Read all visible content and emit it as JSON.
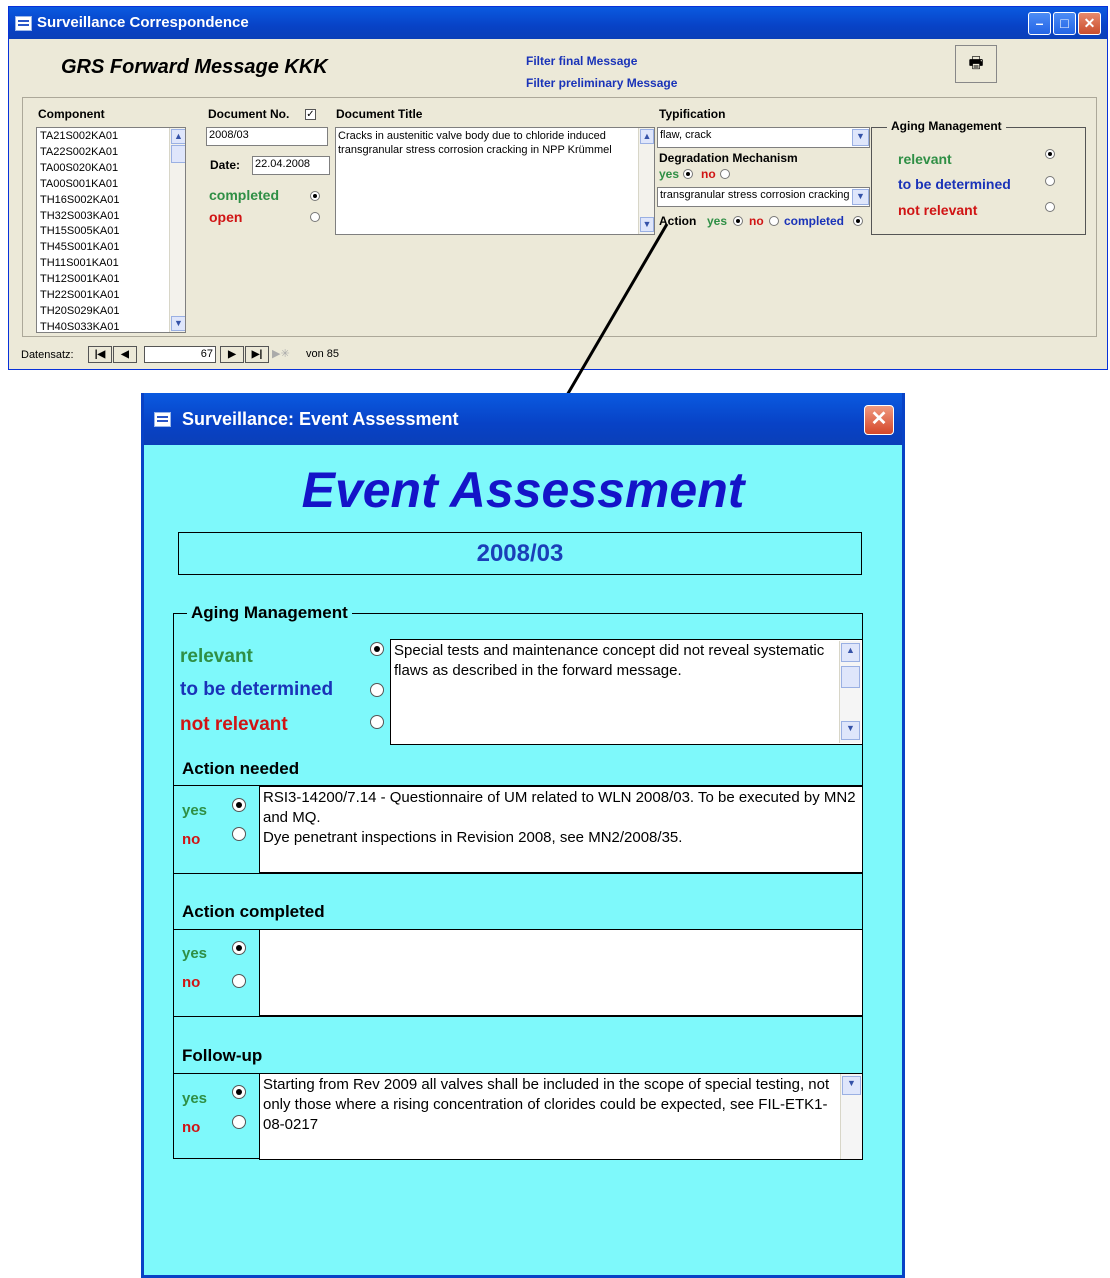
{
  "win1": {
    "title": "Surveillance Correspondence",
    "heading": "GRS Forward Message KKK",
    "filter_final": "Filter final Message",
    "filter_preliminary": "Filter preliminary Message",
    "component_label": "Component",
    "components": [
      "TA21S002KA01",
      "TA22S002KA01",
      "TA00S020KA01",
      "TA00S001KA01",
      "TH16S002KA01",
      "TH32S003KA01",
      "TH15S005KA01",
      "TH45S001KA01",
      "TH11S001KA01",
      "TH12S001KA01",
      "TH22S001KA01",
      "TH20S029KA01",
      "TH40S033KA01"
    ],
    "docno_label": "Document No.",
    "docno_value": "2008/03",
    "date_label": "Date:",
    "date_value": "22.04.2008",
    "completed_label": "completed",
    "open_label": "open",
    "doctitle_label": "Document Title",
    "doctitle_value": "Cracks in austenitic valve body due to chloride induced transgranular stress corrosion cracking in NPP Krümmel",
    "typification_label": "Typification",
    "typification_value": "flaw, crack",
    "degradation_label": "Degradation Mechanism",
    "yes": "yes",
    "no": "no",
    "degradation_value": "transgranular stress corrosion cracking",
    "action_label": "Action",
    "completed_small": "completed",
    "aging_label": "Aging Management",
    "relevant": "relevant",
    "tbd": "to be determined",
    "not_relevant": "not relevant",
    "record_label": "Datensatz:",
    "record_current": "67",
    "record_of": "von 85"
  },
  "win2": {
    "title": "Surveillance: Event Assessment",
    "heading": "Event Assessment",
    "doc_number": "2008/03",
    "aging_label": "Aging Management",
    "relevant": "relevant",
    "tbd": "to be determined",
    "not_relevant": "not relevant",
    "aging_text": "Special tests and maintenance concept did not reveal systematic flaws as described in the forward message.",
    "action_needed_label": "Action needed",
    "action_needed_text_1": "RSI3-14200/7.14 - Questionnaire of UM related to WLN 2008/03. To be executed by MN2 and MQ.",
    "action_needed_text_2": "Dye penetrant inspections in Revision 2008, see MN2/2008/35.",
    "action_completed_label": "Action completed",
    "followup_label": "Follow-up",
    "followup_text": "Starting from Rev 2009 all valves shall be included in the scope of special testing, not only those where a rising concentration of clorides could be expected, see FIL-ETK1-08-0217",
    "yes": "yes",
    "no": "no"
  },
  "colors": {
    "xp_blue": "#0842c6",
    "cyan_bg": "#7ef9fb",
    "green": "#2f8f45",
    "blue_text": "#1a33b8",
    "red": "#d01414"
  }
}
